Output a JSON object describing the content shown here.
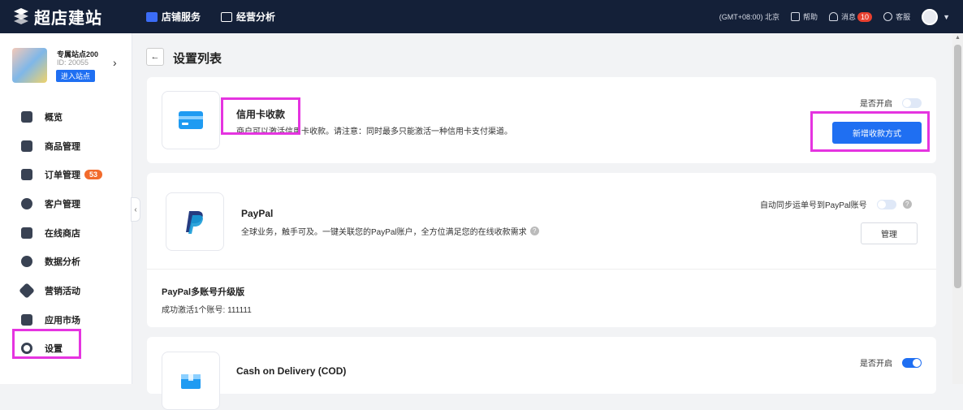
{
  "brand": {
    "name": "超店建站"
  },
  "topnav": {
    "tabs": [
      {
        "label": "店铺服务"
      },
      {
        "label": "经营分析"
      }
    ],
    "timezone": "(GMT+08:00) 北京",
    "help": "帮助",
    "messages": "消息",
    "messages_count": "10",
    "service": "客服"
  },
  "store": {
    "name": "专属站点200",
    "id": "ID: 20055",
    "enter": "进入站点"
  },
  "menu": [
    {
      "label": "概览",
      "icon": "overview-icon"
    },
    {
      "label": "商品管理",
      "icon": "bag-icon"
    },
    {
      "label": "订单管理",
      "icon": "cart-icon",
      "badge": "53"
    },
    {
      "label": "客户管理",
      "icon": "user-icon"
    },
    {
      "label": "在线商店",
      "icon": "store-icon"
    },
    {
      "label": "数据分析",
      "icon": "pie-chart-icon"
    },
    {
      "label": "营销活动",
      "icon": "tag-icon"
    },
    {
      "label": "应用市场",
      "icon": "apps-icon"
    },
    {
      "label": "设置",
      "icon": "settings-icon"
    }
  ],
  "page": {
    "title": "设置列表"
  },
  "credit_card": {
    "name": "信用卡收款",
    "desc": "商户可以激活信用卡收款。请注意：同时最多只能激活一种信用卡支付渠道。",
    "enable_label": "是否开启",
    "add_button": "新增收款方式"
  },
  "paypal": {
    "name": "PayPal",
    "desc": "全球业务，触手可及。一键关联您的PayPal账户，全方位满足您的在线收款需求",
    "sync_label": "自动同步运单号到PayPal账号",
    "manage_button": "管理",
    "multi_title": "PayPal多账号升级版",
    "multi_status": "成功激活1个账号: 111111"
  },
  "cod": {
    "name": "Cash on Delivery (COD)",
    "enable_label": "是否开启"
  },
  "colors": {
    "primary": "#1f6ff2",
    "topbar": "#142038",
    "highlight": "#e534e0",
    "badge": "#f26b2c"
  }
}
